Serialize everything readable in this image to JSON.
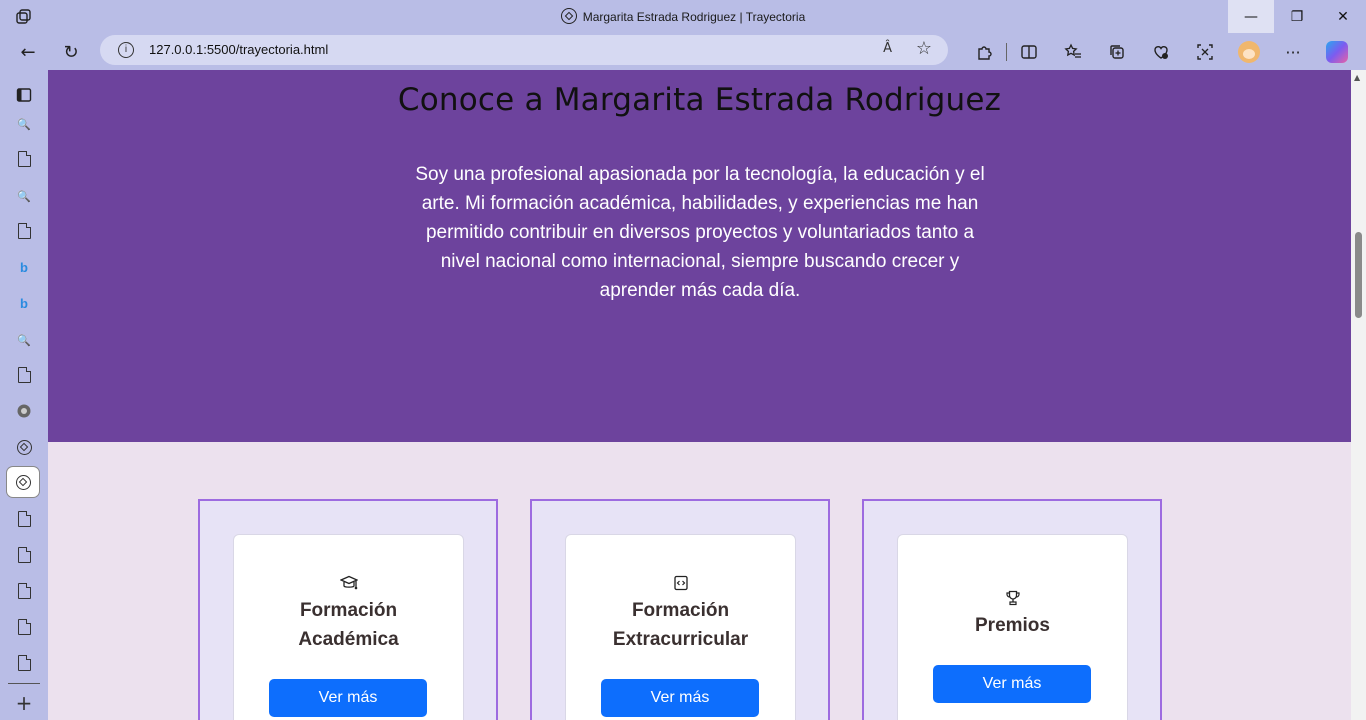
{
  "window": {
    "title": "Margarita Estrada Rodriguez | Trayectoria",
    "controls": {
      "minimize": "—",
      "restore": "❐",
      "close": "✕"
    }
  },
  "toolbar": {
    "back": "←",
    "refresh": "↻",
    "url": "127.0.0.1:5500/trayectoria.html",
    "info": "i",
    "read_aloud": "Â",
    "favorite": "☆",
    "more": "···"
  },
  "page": {
    "heading": "Conoce a Margarita Estrada Rodriguez",
    "intro": "Soy una profesional apasionada por la tecnología, la educación y el arte. Mi formación académica, habilidades, y experiencias me han permitido contribuir en diversos proyectos y voluntariados tanto a nivel nacional como internacional, siempre buscando crecer y aprender más cada día.",
    "cards": [
      {
        "icon": "🎓",
        "icon_name": "graduation-cap-icon",
        "title_line1": "Formación",
        "title_line2": "Académica",
        "button": "Ver más"
      },
      {
        "icon": "⟨⟩",
        "icon_name": "code-file-icon",
        "title_line1": "Formación",
        "title_line2": "Extracurricular",
        "button": "Ver más"
      },
      {
        "icon": "🏆",
        "icon_name": "trophy-icon",
        "title_line1": "Premios",
        "title_line2": "",
        "button": "Ver más"
      }
    ]
  },
  "sidebar": {
    "add": "+"
  },
  "colors": {
    "hero_bg": "#6d439d",
    "section_bg": "#ece1ee",
    "card_border": "#9d6be0",
    "button_bg": "#0d6efd",
    "chrome_bg": "#b9bde6"
  }
}
